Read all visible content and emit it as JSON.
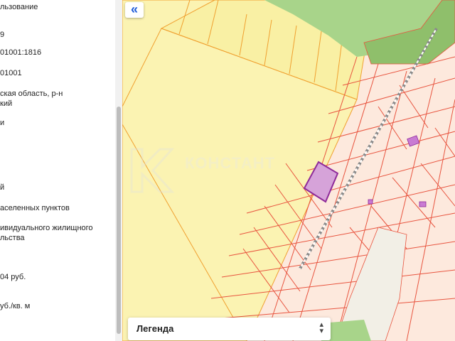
{
  "info_panel": {
    "rows": [
      "льзование",
      "9",
      "01001:1816",
      "01001",
      "ская область, р-н",
      "кий",
      "и",
      "й",
      "аселенных пунктов",
      "ивидуального жилищного",
      "льства",
      "04 руб.",
      "уб./кв. м"
    ]
  },
  "map": {
    "collapse_icon": "«",
    "legend_label": "Легенда",
    "watermark_text": "КОНСТАНТ",
    "colors": {
      "plot_fill": "#fde9dd",
      "plot_border": "#e8543f",
      "zone_fill": "#fbf3b2",
      "zone_border": "#f0a030",
      "forest": "#a8d48a",
      "selected_parcel": "#d6a3d9",
      "selected_border": "#8e2a9a"
    }
  }
}
